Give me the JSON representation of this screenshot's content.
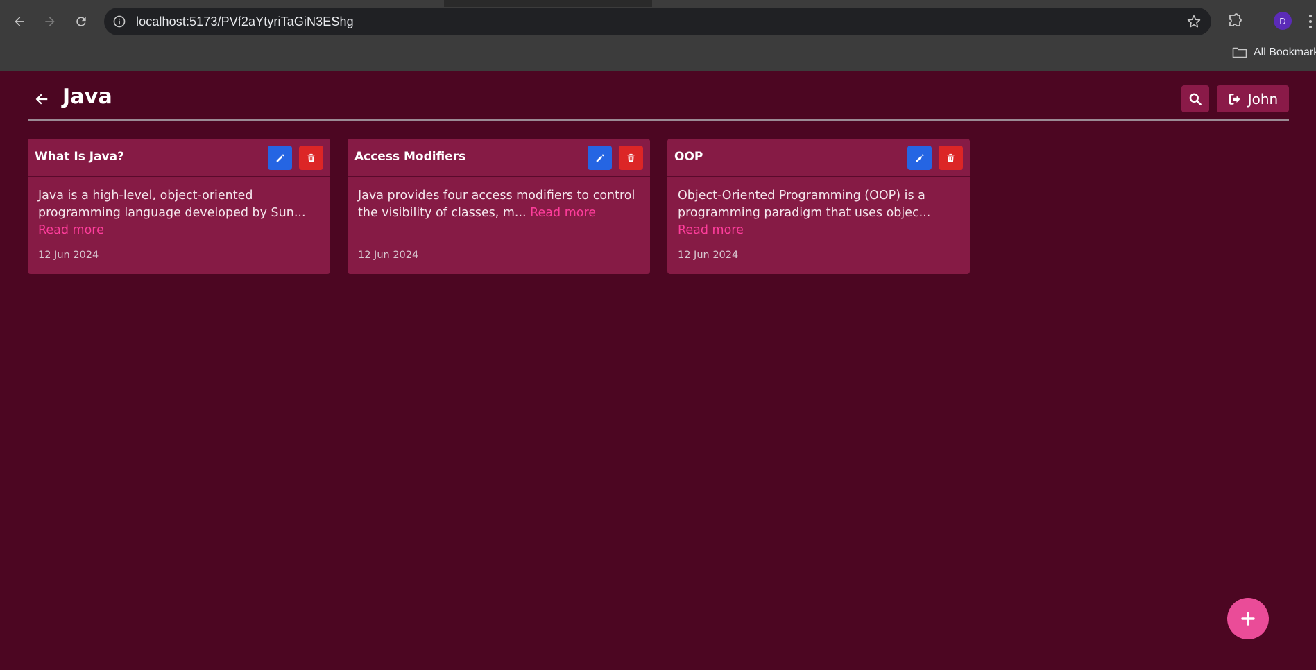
{
  "browser": {
    "url": "localhost:5173/PVf2aYtyriTaGiN3EShg",
    "bookmarks_label": "All Bookmarks",
    "profile_initial": "D",
    "icons": [
      "back-arrow-icon",
      "forward-arrow-icon",
      "reload-icon",
      "info-icon",
      "star-icon",
      "puzzle-icon",
      "kebab-menu-icon",
      "folder-icon"
    ]
  },
  "header": {
    "title": "Java",
    "user_name": "John",
    "icons": [
      "arrow-left-icon",
      "search-icon",
      "sign-out-icon"
    ]
  },
  "cards": [
    {
      "title": "What Is Java?",
      "body": "Java is a high-level, object-oriented programming language developed by Sun...",
      "read_more": "Read more",
      "date": "12 Jun 2024"
    },
    {
      "title": "Access Modifiers",
      "body": "Java provides four access modifiers to control the visibility of classes, m...",
      "read_more": "Read more",
      "date": "12 Jun 2024"
    },
    {
      "title": "OOP",
      "body": "Object-Oriented Programming (OOP) is a programming paradigm that uses objec...",
      "read_more": "Read more",
      "date": "12 Jun 2024"
    }
  ],
  "colors": {
    "background": "#4c0622",
    "card": "#861b45",
    "edit": "#2565e3",
    "delete": "#dc2626",
    "accent": "#ea4c98",
    "link": "#ff3d9c"
  }
}
